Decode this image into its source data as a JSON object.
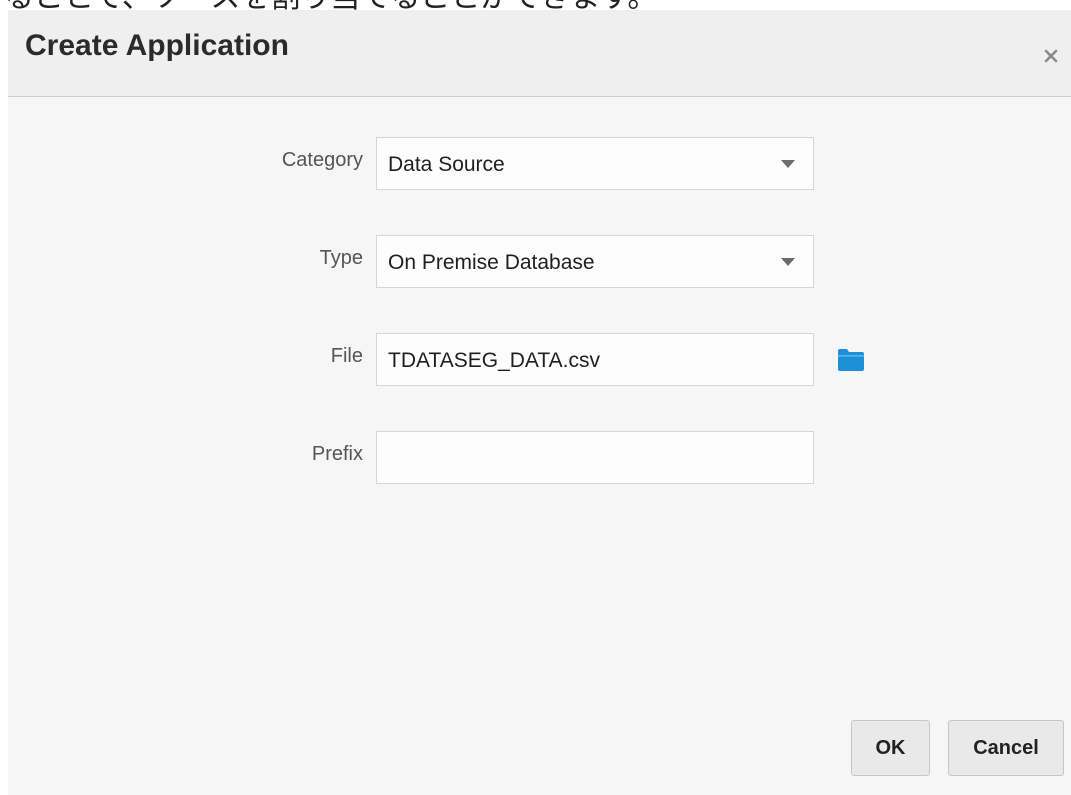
{
  "top_strip_text": "ることで、ソースを割り当てることができます。",
  "dialog": {
    "title": "Create Application",
    "close_icon": "close-icon"
  },
  "form": {
    "category": {
      "label": "Category",
      "value": "Data Source",
      "icon": "chevron-down-icon"
    },
    "type": {
      "label": "Type",
      "value": "On Premise Database",
      "icon": "chevron-down-icon"
    },
    "file": {
      "label": "File",
      "value": "TDATASEG_DATA.csv",
      "browse_icon": "folder-icon"
    },
    "prefix": {
      "label": "Prefix",
      "value": ""
    }
  },
  "buttons": {
    "ok_label": "OK",
    "cancel_label": "Cancel"
  },
  "colors": {
    "folder_icon": "#1e90d8",
    "dialog_background": "#f6f6f6"
  }
}
